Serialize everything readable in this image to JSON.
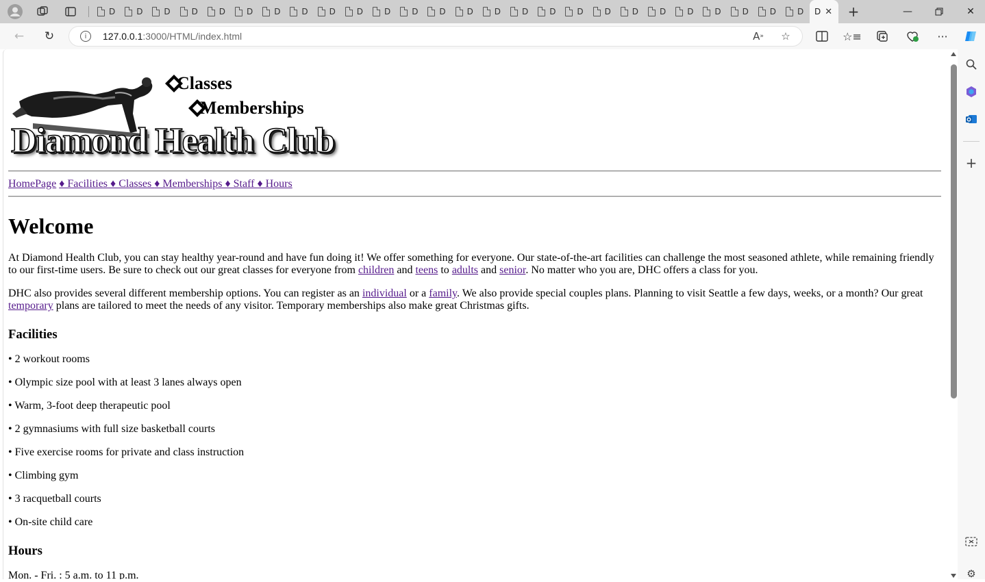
{
  "browser": {
    "active_tab_label": "D",
    "url_host": "127.0.0.1",
    "url_path": ":3000/HTML/index.html"
  },
  "header": {
    "logo_text": "Diamond Health Club",
    "classes_link": "Classes",
    "memberships_link": "Memberships"
  },
  "nav": {
    "items": [
      "HomePage",
      "♦ Facilities ",
      "♦ Classes ",
      "♦ Memberships ",
      " ♦ Staff ",
      " ♦ Hours"
    ]
  },
  "welcome": {
    "title": "Welcome",
    "p1_a": "At Diamond Health Club, you can stay healthy year-round and have fun doing it! We offer something for everyone. Our state-of-the-art facilities can challenge the most seasoned athlete, while remaining friendly to our first-time users. Be sure to check out our great classes for everyone from ",
    "p1_link1": "children",
    "p1_b": " and ",
    "p1_link2": "teens",
    "p1_c": " to ",
    "p1_link3": "adults",
    "p1_d": " and ",
    "p1_link4": "senior",
    "p1_e": ". No matter who you are, DHC offers a class for you.",
    "p2_a": "DHC also provides several different membership options. You can register as an ",
    "p2_link1": "individual",
    "p2_b": " or a ",
    "p2_link2": "family",
    "p2_c": ". We also provide special couples plans. Planning to visit Seattle a few days, weeks, or a month? Our great ",
    "p2_link3": "temporary",
    "p2_d": " plans are tailored to meet the needs of any visitor. Temporary memberships also make great Christmas gifts."
  },
  "facilities": {
    "title": "Facilities",
    "items": [
      "• 2 workout rooms",
      "• Olympic size pool with at least 3 lanes always open",
      "• Warm, 3-foot deep therapeutic pool",
      "• 2 gymnasiums with full size basketball courts",
      "• Five exercise rooms for private and class instruction",
      "• Climbing gym",
      "• 3 racquetball courts",
      "• On-site child care"
    ]
  },
  "hours": {
    "title": "Hours",
    "line1": "Mon. - Fri. : 5 a.m. to 11 p.m."
  }
}
